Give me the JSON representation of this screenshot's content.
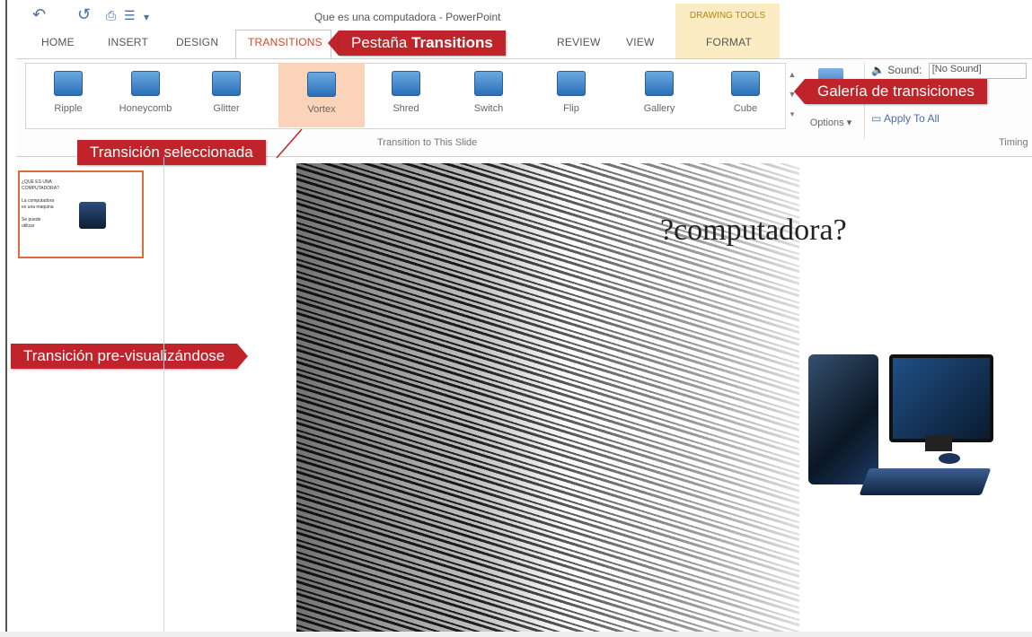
{
  "window": {
    "title": "Que es una computadora - PowerPoint"
  },
  "quick_access": {
    "undo": "↶",
    "redo": "↺",
    "sep": "▾"
  },
  "context_tab_group": {
    "label": "DRAWING TOOLS"
  },
  "tabs": [
    {
      "label": "HOME"
    },
    {
      "label": "INSERT"
    },
    {
      "label": "DESIGN"
    },
    {
      "label": "TRANSITIONS"
    },
    {
      "label": "REVIEW"
    },
    {
      "label": "VIEW"
    },
    {
      "label": "FORMAT"
    }
  ],
  "gallery": {
    "items": [
      {
        "label": "Ripple"
      },
      {
        "label": "Honeycomb"
      },
      {
        "label": "Glitter"
      },
      {
        "label": "Vortex"
      },
      {
        "label": "Shred"
      },
      {
        "label": "Switch"
      },
      {
        "label": "Flip"
      },
      {
        "label": "Gallery"
      },
      {
        "label": "Cube"
      }
    ],
    "group_label": "Transition to This Slide"
  },
  "effect_options": {
    "label": "Options ▾"
  },
  "timing": {
    "sound_label": "Sound:",
    "sound_value": "[No Sound]",
    "apply_all": "Apply To All",
    "group_label": "Timing"
  },
  "callouts": {
    "tab_prefix": "Pestaña ",
    "tab_bold": "Transitions",
    "gallery": "Galería de transiciones",
    "selected": "Transición seleccionada",
    "preview": "Transición pre-visualizándose"
  },
  "slide": {
    "title": "?computadora?"
  },
  "colors": {
    "accent": "#d24726",
    "callout": "#c0232a",
    "selected_bg": "#fad3b8"
  }
}
